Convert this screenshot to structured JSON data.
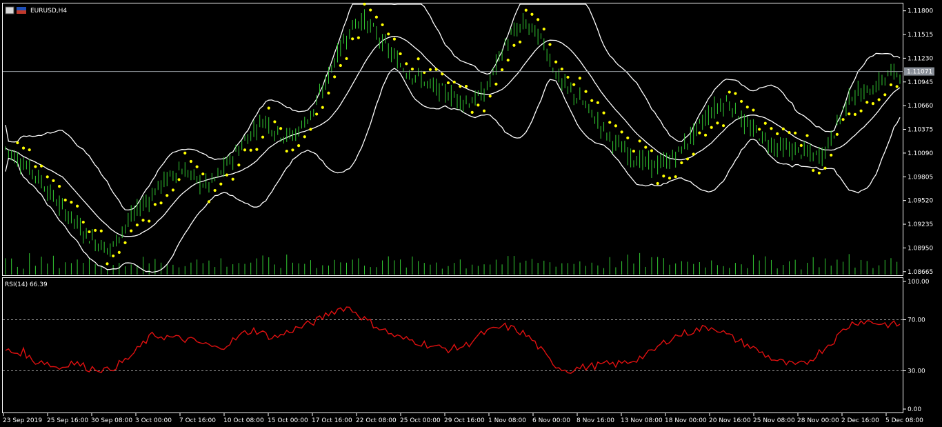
{
  "window": {
    "symbol_title": "EURUSD,H4",
    "current_price": "1.11071"
  },
  "price_axis": {
    "tick_labels": [
      "1.11800",
      "1.11515",
      "1.11230",
      "1.10945",
      "1.10660",
      "1.10375",
      "1.10090",
      "1.09805",
      "1.09520",
      "1.09235",
      "1.08950",
      "1.08665"
    ],
    "tick_values": [
      1.118,
      1.11515,
      1.1123,
      1.10945,
      1.1066,
      1.10375,
      1.1009,
      1.09805,
      1.0952,
      1.09235,
      1.0895,
      1.08665
    ],
    "range": [
      1.0863,
      1.1188
    ]
  },
  "rsi_panel": {
    "title": "RSI(14) 66.39",
    "levels_labels": [
      "100.00",
      "70.00",
      "30.00",
      "0.00"
    ],
    "levels": [
      100,
      70,
      30,
      0
    ],
    "dashed_levels": [
      70,
      30
    ]
  },
  "time_axis": {
    "labels": [
      "23 Sep 2019",
      "25 Sep 16:00",
      "30 Sep 08:00",
      "3 Oct 00:00",
      "7 Oct 16:00",
      "10 Oct 08:00",
      "15 Oct 00:00",
      "17 Oct 16:00",
      "22 Oct 08:00",
      "25 Oct 00:00",
      "29 Oct 16:00",
      "1 Nov 08:00",
      "6 Nov 00:00",
      "8 Nov 16:00",
      "13 Nov 08:00",
      "18 Nov 00:00",
      "20 Nov 16:00",
      "25 Nov 08:00",
      "28 Nov 00:00",
      "2 Dec 16:00",
      "5 Dec 08:00"
    ]
  },
  "colors": {
    "background": "#000000",
    "candles": "#33cc33",
    "bollinger": "#ffffff",
    "parabolic_sar": "#ffff00",
    "volume": "#33cc33",
    "rsi_line": "#e01010",
    "price_line": "#9aa0a6"
  },
  "chart_data": [
    {
      "type": "line",
      "title": "EURUSD,H4",
      "x_labels": [
        "23 Sep 2019",
        "25 Sep 16:00",
        "30 Sep 08:00",
        "3 Oct 00:00",
        "7 Oct 16:00",
        "10 Oct 08:00",
        "15 Oct 00:00",
        "17 Oct 16:00",
        "22 Oct 08:00",
        "25 Oct 00:00",
        "29 Oct 16:00",
        "1 Nov 08:00",
        "6 Nov 00:00",
        "8 Nov 16:00",
        "13 Nov 08:00",
        "18 Nov 00:00",
        "20 Nov 16:00",
        "25 Nov 08:00",
        "28 Nov 00:00",
        "2 Dec 16:00",
        "5 Dec 08:00"
      ],
      "ylim": [
        1.0863,
        1.1188
      ],
      "series": [
        {
          "type": "close",
          "values": [
            1.1015,
            1.1005,
            1.0995,
            1.0985,
            1.097,
            1.0955,
            1.094,
            1.093,
            1.0915,
            1.0905,
            1.0898,
            1.0893,
            1.0915,
            1.093,
            1.0945,
            1.0955,
            1.097,
            1.098,
            1.099,
            1.0985,
            1.0975,
            1.097,
            1.098,
            1.0995,
            1.101,
            1.1025,
            1.104,
            1.105,
            1.1035,
            1.103,
            1.103,
            1.1045,
            1.106,
            1.1085,
            1.1115,
            1.114,
            1.116,
            1.117,
            1.116,
            1.1145,
            1.113,
            1.1115,
            1.1105,
            1.11,
            1.109,
            1.1085,
            1.108,
            1.1075,
            1.107,
            1.1075,
            1.1085,
            1.1115,
            1.114,
            1.1155,
            1.1165,
            1.1155,
            1.114,
            1.111,
            1.109,
            1.108,
            1.107,
            1.1055,
            1.104,
            1.1025,
            1.1015,
            1.1005,
            1.1,
            1.0995,
            1.0995,
            1.1,
            1.101,
            1.1025,
            1.104,
            1.1055,
            1.1065,
            1.107,
            1.106,
            1.104,
            1.1035,
            1.1025,
            1.1018,
            1.1015,
            1.1012,
            1.101,
            1.1005,
            1.1008,
            1.103,
            1.106,
            1.108,
            1.108,
            1.1085,
            1.1095,
            1.1105,
            1.1107
          ]
        }
      ],
      "current_price": 1.11071
    },
    {
      "type": "line",
      "title": "RSI(14) 66.39",
      "ylim": [
        0,
        100
      ],
      "levels": [
        70,
        30
      ],
      "series": [
        {
          "values": [
            46,
            44,
            45,
            37,
            38,
            34,
            32,
            37,
            35,
            32,
            32,
            30,
            34,
            38,
            44,
            52,
            58,
            57,
            56,
            55,
            54,
            52,
            50,
            47,
            51,
            55,
            60,
            62,
            59,
            56,
            58,
            62,
            64,
            67,
            70,
            75,
            78,
            80,
            76,
            70,
            66,
            62,
            58,
            55,
            54,
            52,
            50,
            48,
            47,
            48,
            50,
            56,
            60,
            62,
            65,
            63,
            60,
            55,
            47,
            38,
            33,
            30,
            32,
            33,
            34,
            35,
            35,
            36,
            38,
            41,
            44,
            50,
            55,
            58,
            60,
            62,
            64,
            64,
            59,
            55,
            52,
            48,
            44,
            40,
            37,
            35,
            34,
            37,
            43,
            49,
            55,
            63,
            68,
            69,
            68,
            67,
            66,
            66.39
          ]
        }
      ]
    }
  ]
}
